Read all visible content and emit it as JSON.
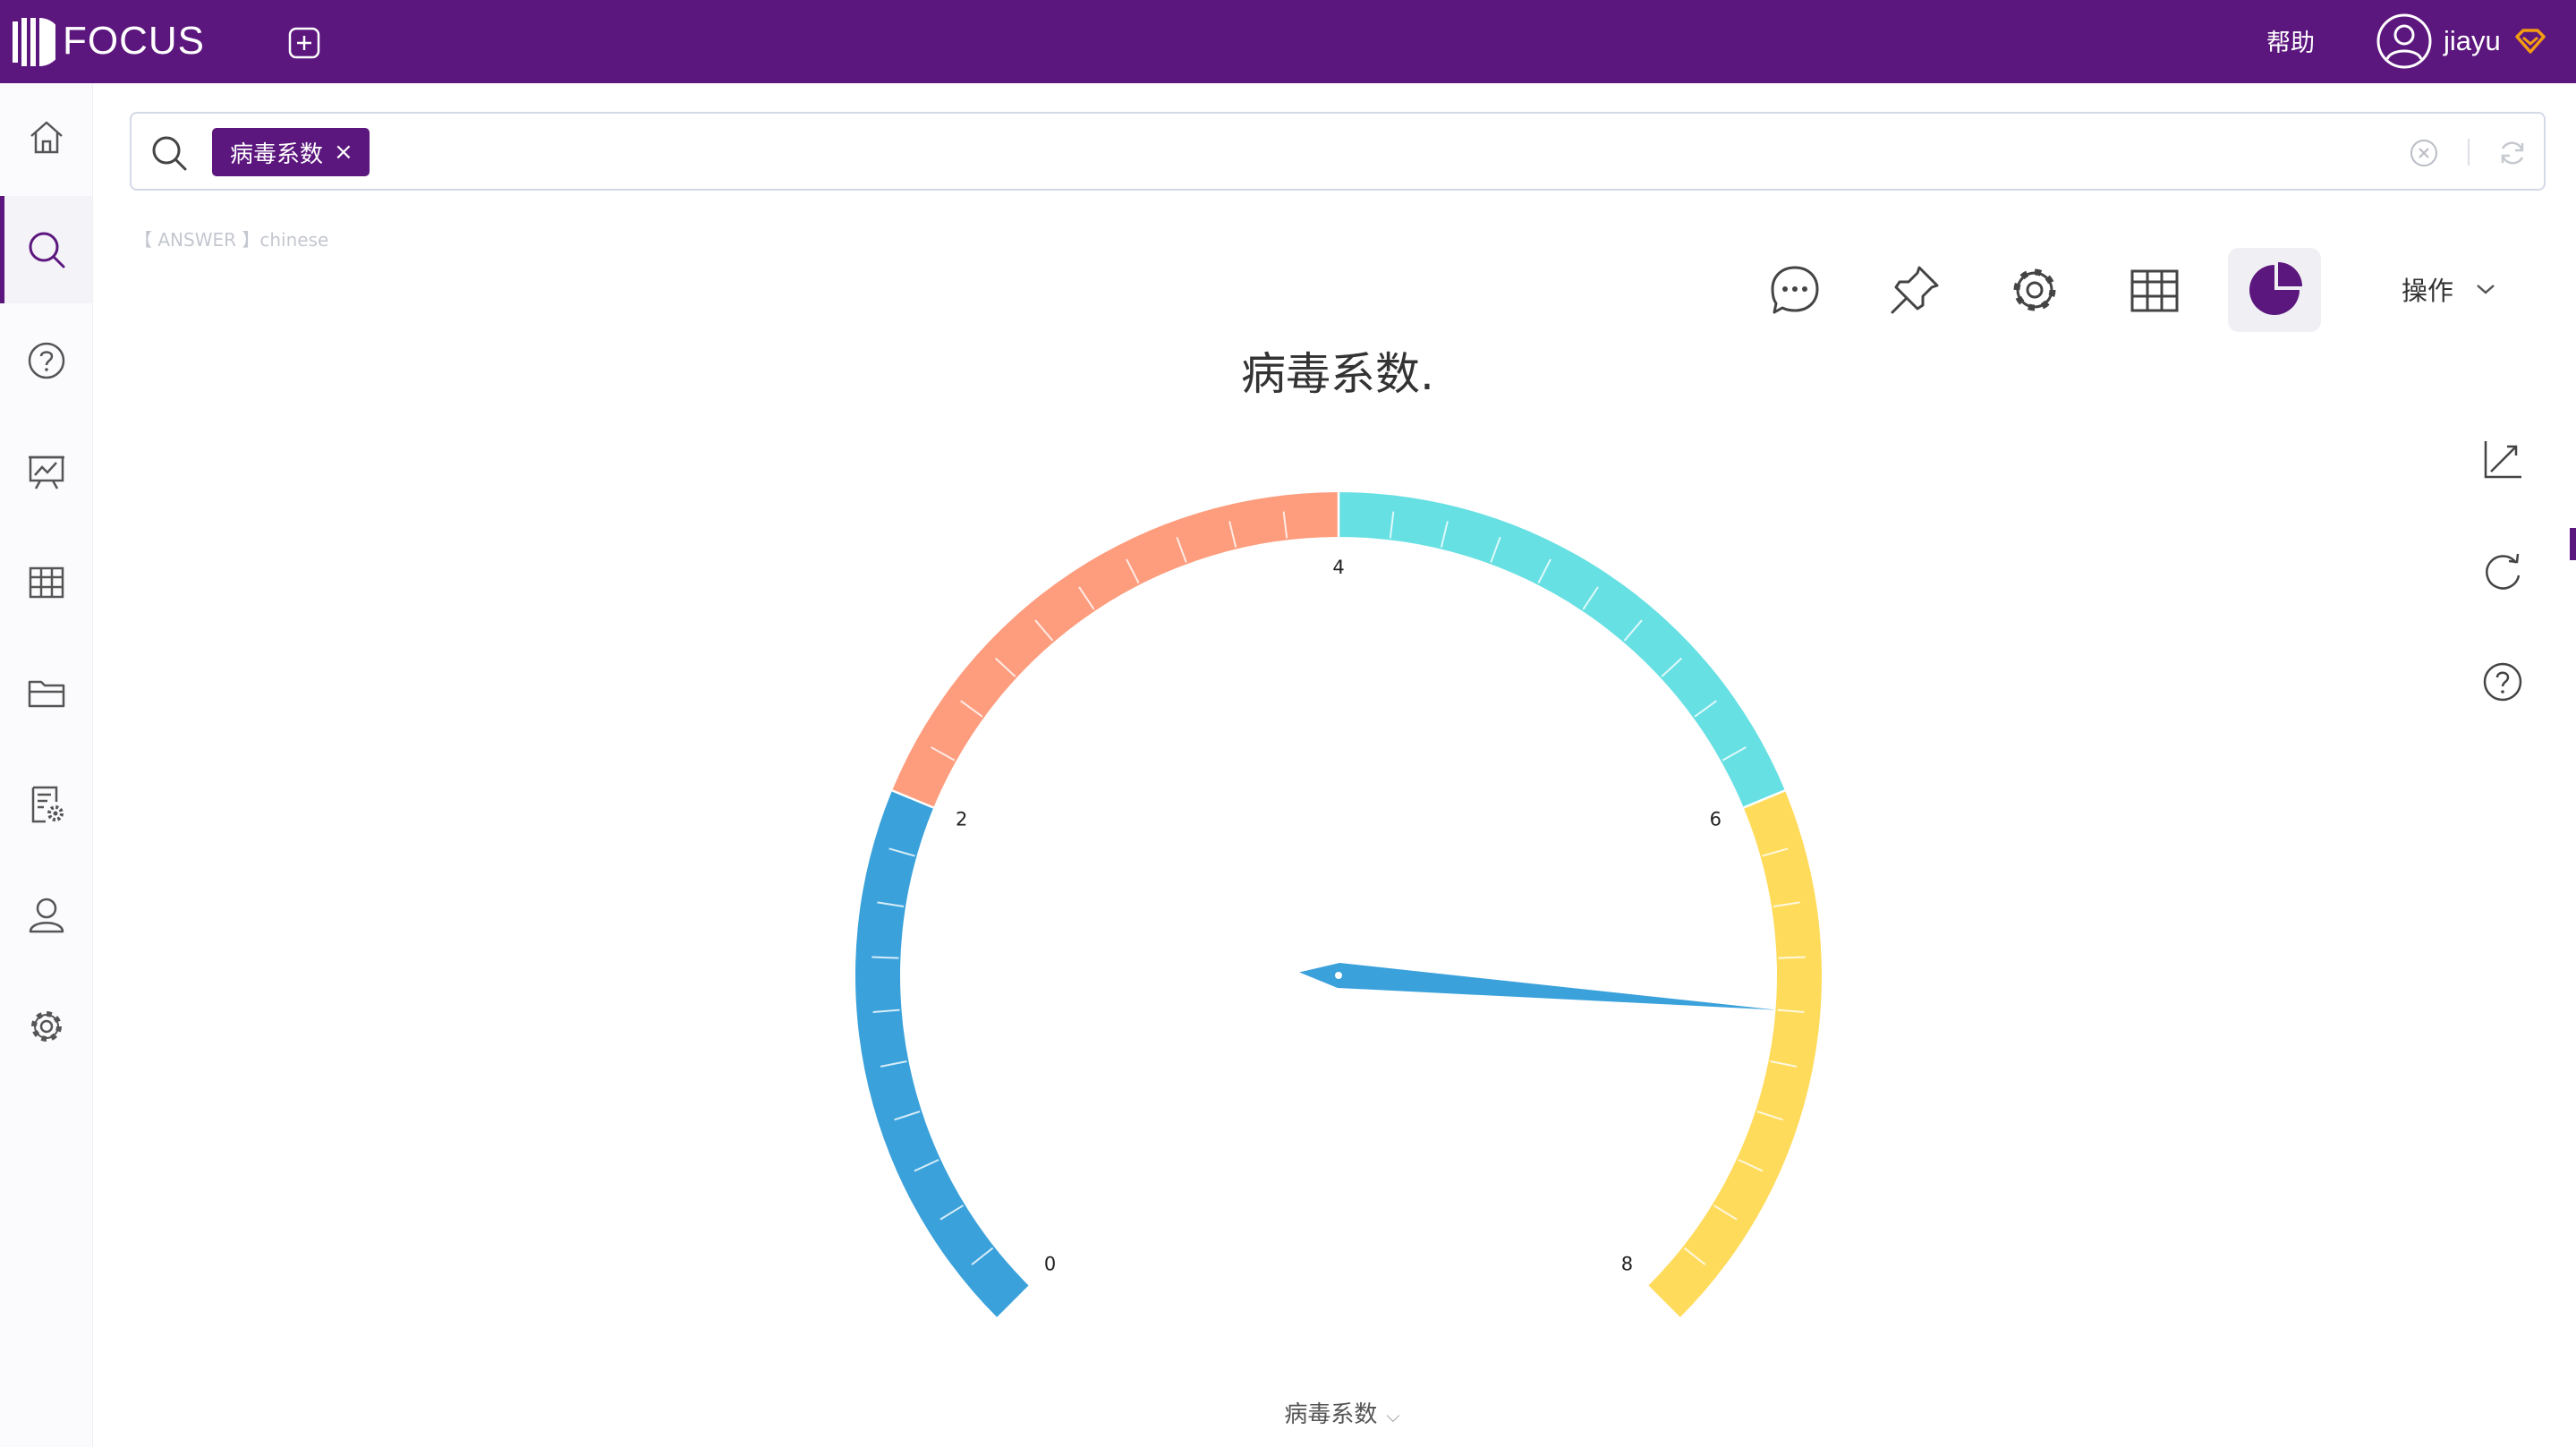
{
  "app": {
    "logo": "FOCUS",
    "help": "帮助",
    "user": "jiayu"
  },
  "sidebar": {
    "items": [
      {
        "icon": "home-icon"
      },
      {
        "icon": "search-icon",
        "active": true
      },
      {
        "icon": "help-circle-icon"
      },
      {
        "icon": "board-chart-icon"
      },
      {
        "icon": "table-icon"
      },
      {
        "icon": "folder-icon"
      },
      {
        "icon": "doc-settings-icon"
      },
      {
        "icon": "user-icon"
      },
      {
        "icon": "gear-icon"
      }
    ]
  },
  "search": {
    "token": "病毒系数",
    "token_remove": "×"
  },
  "answer": {
    "label": "【 ANSWER 】chinese"
  },
  "toolbar": {
    "ops_label": "操作"
  },
  "chart": {
    "title": "病毒系数.",
    "xlabel": "病毒系数"
  },
  "chart_data": {
    "type": "gauge",
    "title": "病毒系数.",
    "min": 0,
    "max": 8,
    "value": 6.8,
    "tick_labels": [
      "0",
      "2",
      "4",
      "6",
      "8"
    ],
    "bands": [
      {
        "from": 0,
        "to": 2,
        "color": "#3aa1db"
      },
      {
        "from": 2,
        "to": 4,
        "color": "#fe9d7e"
      },
      {
        "from": 4,
        "to": 6,
        "color": "#67e0e3"
      },
      {
        "from": 6,
        "to": 8,
        "color": "#ffdb5c"
      }
    ],
    "pointer_color": "#3aa1db",
    "xlabel": "病毒系数"
  }
}
